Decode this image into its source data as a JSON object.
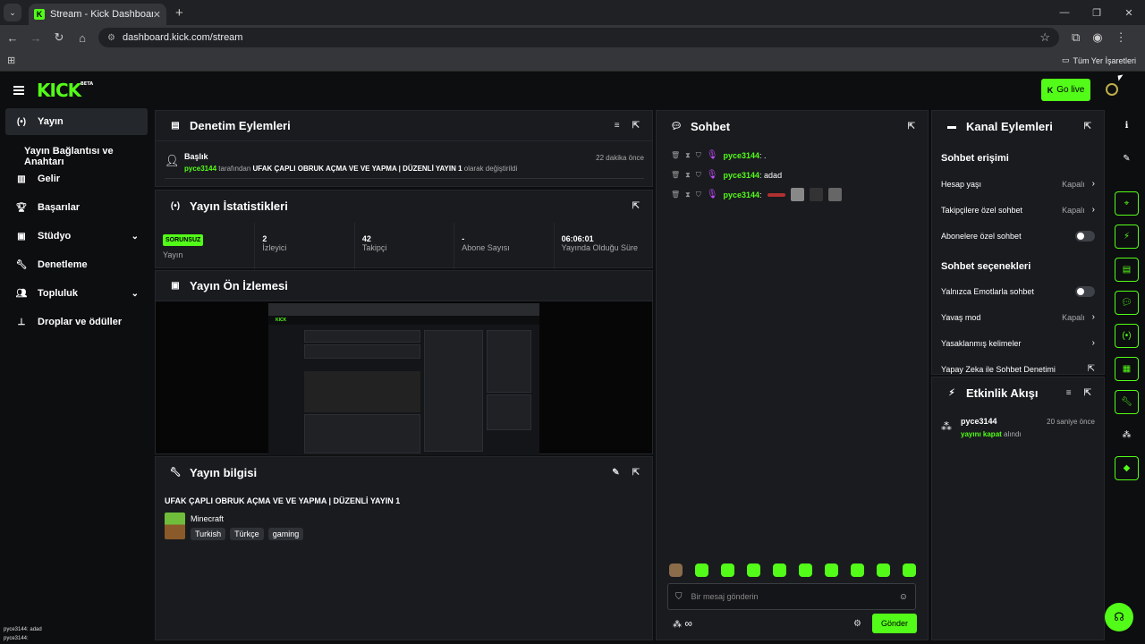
{
  "browser": {
    "tab_title": "Stream - Kick Dashboard",
    "url": "dashboard.kick.com/stream",
    "bookmarks_label": "Tüm Yer İşaretleri"
  },
  "header": {
    "logo": "KICK",
    "beta": "BETA",
    "go_live": "Go live"
  },
  "sidebar": {
    "items": [
      {
        "label": "Yayın",
        "icon": "broadcast-icon"
      },
      {
        "label": "Yayın Bağlantısı ve Anahtarı"
      },
      {
        "label": "Gelir",
        "icon": "chart-icon"
      },
      {
        "label": "Başarılar",
        "icon": "trophy-icon"
      },
      {
        "label": "Stüdyo",
        "icon": "studio-icon"
      },
      {
        "label": "Denetleme",
        "icon": "wrench-icon"
      },
      {
        "label": "Topluluk",
        "icon": "community-icon"
      },
      {
        "label": "Droplar ve ödüller",
        "icon": "drops-icon"
      }
    ],
    "bottom_chat": [
      {
        "user": "pyce3144",
        "text": ": adad"
      },
      {
        "user": "pyce3144",
        "text": ":"
      }
    ]
  },
  "audit": {
    "title": "Denetim Eylemleri",
    "entry_title": "Başlık",
    "entry_user": "pyce3144",
    "entry_by": "tarafından",
    "entry_value": "UFAK ÇAPLI OBRUK AÇMA VE VE YAPMA | DÜZENLİ YAYIN 1",
    "entry_suffix": "olarak değiştirildi",
    "entry_time": "22 dakika önce"
  },
  "stats": {
    "title": "Yayın İstatistikleri",
    "status_badge": "SORUNSUZ",
    "status_label": "Yayın",
    "viewers_value": "2",
    "viewers_label": "İzleyici",
    "followers_value": "42",
    "followers_label": "Takipçi",
    "subs_value": "-",
    "subs_label": "Abone Sayısı",
    "uptime_value": "06:06:01",
    "uptime_label": "Yayında Olduğu Süre"
  },
  "preview": {
    "title": "Yayın Ön İzlemesi"
  },
  "stream_info": {
    "title": "Yayın bilgisi",
    "stream_title": "UFAK ÇAPLI OBRUK AÇMA VE VE YAPMA | DÜZENLİ YAYIN 1",
    "category": "Minecraft",
    "tags": [
      "Turkish",
      "Türkçe",
      "gaming"
    ]
  },
  "chat": {
    "title": "Sohbet",
    "messages": [
      {
        "user": "pyce3144",
        "text": "."
      },
      {
        "user": "pyce3144",
        "text": "adad"
      },
      {
        "user": "pyce3144",
        "text": ""
      }
    ],
    "input_placeholder": "Bir mesaj gönderin",
    "send": "Gönder",
    "points": "∞"
  },
  "channel_actions": {
    "title": "Kanal Eylemleri",
    "section_access": "Sohbet erişimi",
    "account_age": "Hesap yaşı",
    "account_age_val": "Kapalı",
    "followers_only": "Takipçilere özel sohbet",
    "followers_only_val": "Kapalı",
    "subs_only": "Abonelere özel sohbet",
    "section_options": "Sohbet seçenekleri",
    "emote_only": "Yalnızca Emotlarla sohbet",
    "slow_mode": "Yavaş mod",
    "slow_mode_val": "Kapalı",
    "banned_words": "Yasaklanmış kelimeler",
    "ai_moderation": "Yapay Zeka ile Sohbet Denetimi"
  },
  "activity": {
    "title": "Etkinlik Akışı",
    "user": "pyce3144",
    "action": "yayını kapat",
    "action_suffix": "alındı",
    "time": "20 saniye önce"
  },
  "colors": {
    "accent": "#53fc18",
    "panel": "#191b1f",
    "background": "#0d0e10"
  }
}
